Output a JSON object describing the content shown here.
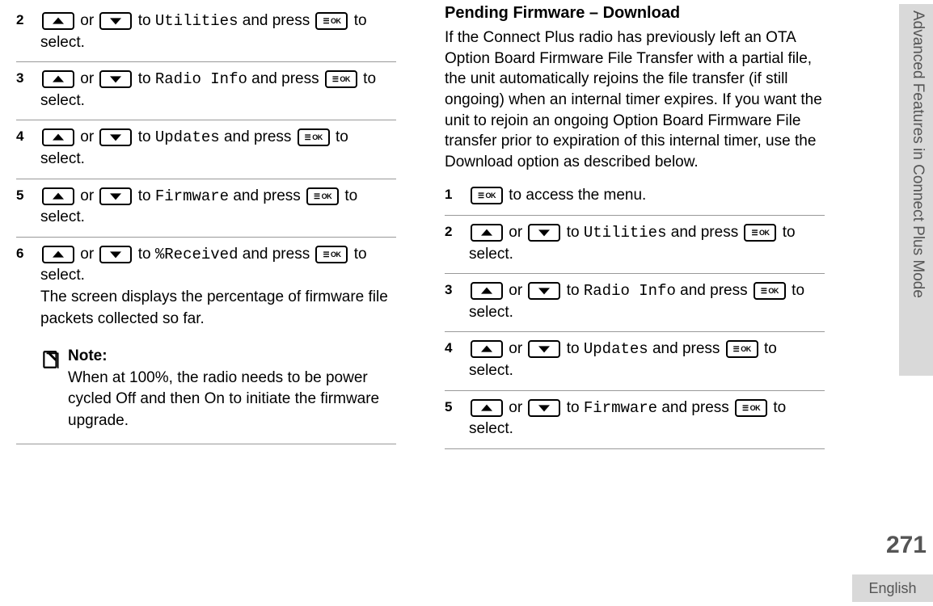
{
  "left": {
    "steps": [
      {
        "num": "2",
        "target": "Utilities"
      },
      {
        "num": "3",
        "target": "Radio Info"
      },
      {
        "num": "4",
        "target": "Updates"
      },
      {
        "num": "5",
        "target": "Firmware"
      },
      {
        "num": "6",
        "target": "%Received",
        "extra": "The screen displays the percentage of firmware file packets collected so far."
      }
    ],
    "note": {
      "title": "Note:",
      "body": "When at 100%, the radio needs to be power cycled Off and then On to initiate the firmware upgrade."
    }
  },
  "right": {
    "title": "Pending Firmware – Download",
    "para": "If the Connect Plus radio has previously left an OTA Option Board Firmware File Transfer with a partial file, the unit automatically rejoins the file transfer (if still ongoing) when an internal timer expires. If you want the unit to rejoin an ongoing Option Board Firmware File transfer prior to expiration of this internal timer, use the Download option as described below.",
    "step1": {
      "num": "1",
      "body": "to access the menu."
    },
    "steps": [
      {
        "num": "2",
        "target": "Utilities"
      },
      {
        "num": "3",
        "target": "Radio Info"
      },
      {
        "num": "4",
        "target": "Updates"
      },
      {
        "num": "5",
        "target": "Firmware"
      }
    ]
  },
  "labels": {
    "or": " or ",
    "to": " to ",
    "andpress": " and press ",
    "toselect": " to select."
  },
  "side": "Advanced Features in Connect Plus Mode",
  "pagenum": "271",
  "lang": "English"
}
